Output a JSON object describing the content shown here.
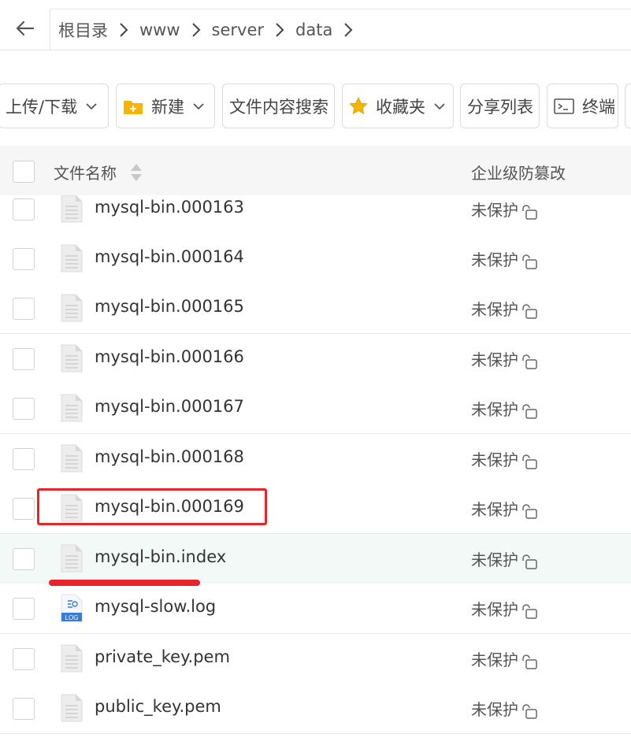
{
  "breadcrumb": {
    "items": [
      "根目录",
      "www",
      "server",
      "data"
    ]
  },
  "toolbar": {
    "upload_download": "上传/下载",
    "new": "新建",
    "content_search": "文件内容搜索",
    "favorites": "收藏夹",
    "share_list": "分享列表",
    "terminal": "终端"
  },
  "table": {
    "col_name": "文件名称",
    "col_protect": "企业级防篡改"
  },
  "files": [
    {
      "name": "mysql-bin.000163",
      "protect": "未保护",
      "icon": "file-icon"
    },
    {
      "name": "mysql-bin.000164",
      "protect": "未保护",
      "icon": "file-icon"
    },
    {
      "name": "mysql-bin.000165",
      "protect": "未保护",
      "icon": "file-icon"
    },
    {
      "name": "mysql-bin.000166",
      "protect": "未保护",
      "icon": "file-icon"
    },
    {
      "name": "mysql-bin.000167",
      "protect": "未保护",
      "icon": "file-icon"
    },
    {
      "name": "mysql-bin.000168",
      "protect": "未保护",
      "icon": "file-icon"
    },
    {
      "name": "mysql-bin.000169",
      "protect": "未保护",
      "icon": "file-icon"
    },
    {
      "name": "mysql-bin.index",
      "protect": "未保护",
      "icon": "file-icon"
    },
    {
      "name": "mysql-slow.log",
      "protect": "未保护",
      "icon": "log-file-icon",
      "icon_label": "LOG"
    },
    {
      "name": "private_key.pem",
      "protect": "未保护",
      "icon": "file-icon"
    },
    {
      "name": "public_key.pem",
      "protect": "未保护",
      "icon": "file-icon"
    }
  ],
  "colors": {
    "annotation_red": "#e8232a",
    "row_highlight": "#f3f9f7",
    "folder_yellow": "#f5b400",
    "log_blue": "#3a7bd5"
  }
}
